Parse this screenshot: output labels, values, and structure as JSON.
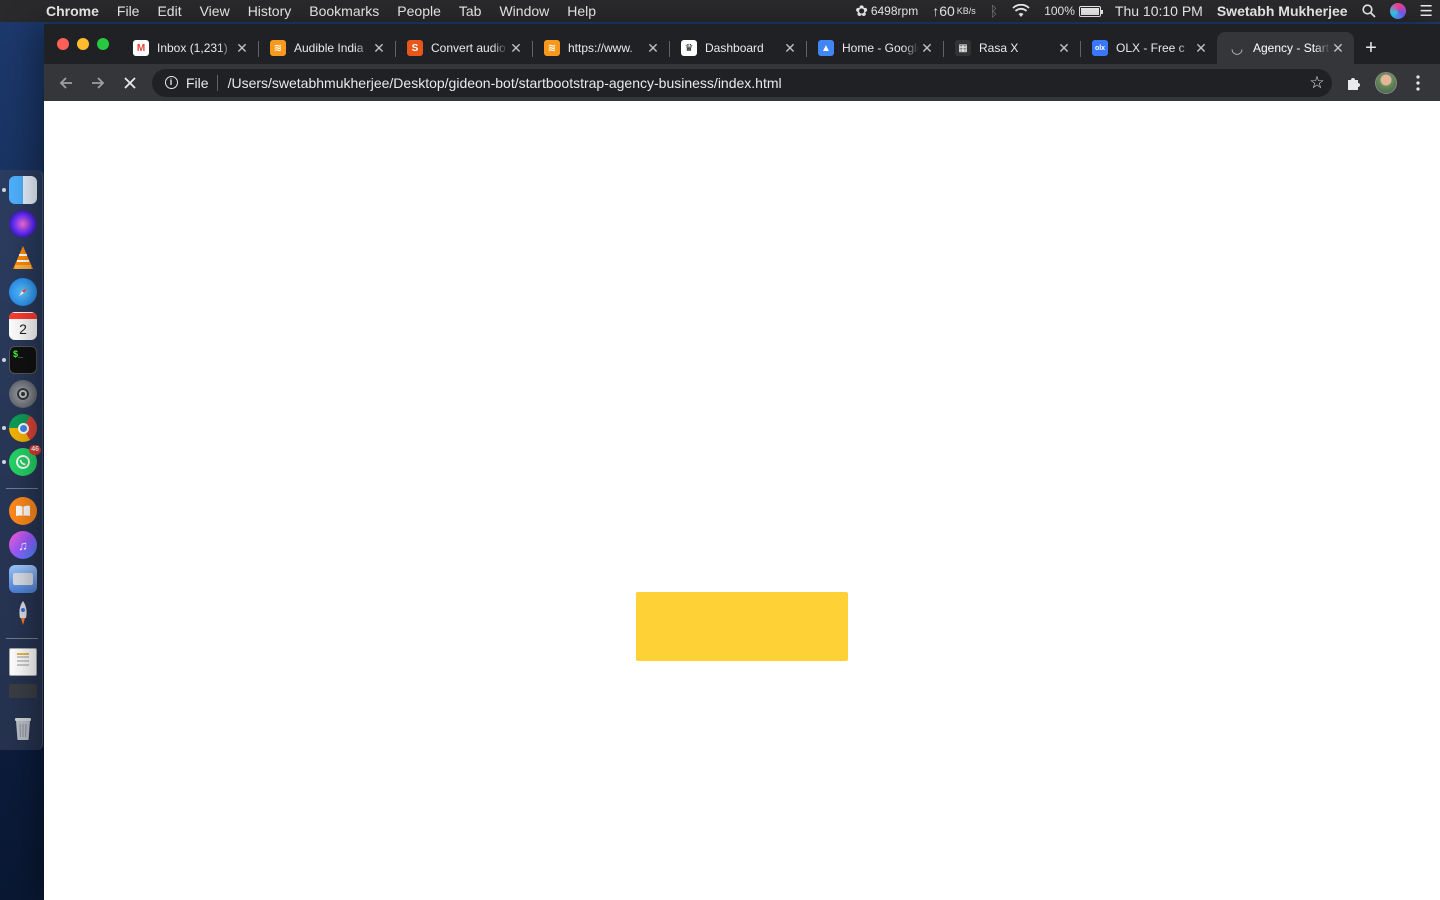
{
  "menubar": {
    "app_name": "Chrome",
    "menus": [
      "File",
      "Edit",
      "View",
      "History",
      "Bookmarks",
      "People",
      "Tab",
      "Window",
      "Help"
    ],
    "fan_speed": "6498rpm",
    "network_speed": "60",
    "network_unit": "KB/s",
    "battery": "100%",
    "clock": "Thu 10:10 PM",
    "user": "Swetabh  Mukherjee"
  },
  "dock": {
    "calendar_day": "2",
    "whatsapp_badge": "46"
  },
  "browser": {
    "tabs": [
      {
        "title": "Inbox (1,231)",
        "icon": "gmail-icon",
        "color": "#ea4335",
        "glyph": "M"
      },
      {
        "title": "Audible India",
        "icon": "audible-icon",
        "color": "#f7991c",
        "glyph": "≋"
      },
      {
        "title": "Convert audio",
        "icon": "convert-icon",
        "color": "#e8561a",
        "glyph": "S"
      },
      {
        "title": "https://www.",
        "icon": "audible-icon",
        "color": "#f7991c",
        "glyph": "≋"
      },
      {
        "title": "Dashboard",
        "icon": "dashboard-icon",
        "color": "#ffffff",
        "glyph": "♛"
      },
      {
        "title": "Home - Google",
        "icon": "google-ads-icon",
        "color": "#4285f4",
        "glyph": "▲"
      },
      {
        "title": "Rasa X",
        "icon": "rasa-icon",
        "color": "#333333",
        "glyph": "▦"
      },
      {
        "title": "OLX - Free c",
        "icon": "olx-icon",
        "color": "#3a77ff",
        "glyph": "olx"
      },
      {
        "title": "Agency - Start",
        "icon": "loading-spinner-icon",
        "color": "#35363a",
        "glyph": "◡"
      }
    ],
    "active_tab_index": 8,
    "address_scheme": "File",
    "address_url": "/Users/swetabhmukherjee/Desktop/gideon-bot/startbootstrap-agency-business/index.html"
  },
  "page": {
    "loader_color": "#fed136"
  }
}
